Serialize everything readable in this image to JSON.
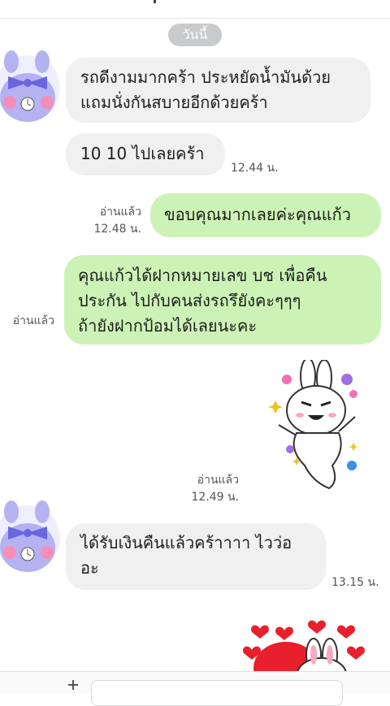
{
  "date_divider": "วันนี้",
  "messages": [
    {
      "text": "รถดีงามมากคร้า ประหยัดน้ำมันด้วย\nแถมนั่งกันสบายอีกด้วยคร้า"
    },
    {
      "text": "10 10 ไปเลยคร้า",
      "time": "12.44 น."
    },
    {
      "text": "ขอบคุณมากเลยค่ะคุณแก้ว",
      "read": "อ่านแล้ว",
      "time": "12.48 น."
    },
    {
      "text": "คุณแก้วได้ฝากหมายเลข บช เพื่อคืน\nประกัน ไปกับคนส่งรถรึยังคะๆๆๆ\nถ้ายังฝากป้อมได้เลยนะคะ",
      "read": "อ่านแล้ว"
    },
    {
      "sticker": "bunny-cheer-sticker",
      "read": "อ่านแล้ว",
      "time": "12.49 น."
    },
    {
      "text": "ได้รับเงินคืนแล้วคร้าาาา ไวว่อ\nอะ",
      "time": "13.15 น."
    },
    {
      "sticker": "bunny-hearts-sticker"
    }
  ],
  "colors": {
    "incoming_bubble": "#f0f0f1",
    "outgoing_bubble": "#ccf3b5",
    "date_pill": "#c9cacc"
  },
  "icons": {
    "avatar": "purple-bunny-avatar-icon",
    "composer_plus": "plus-icon"
  }
}
